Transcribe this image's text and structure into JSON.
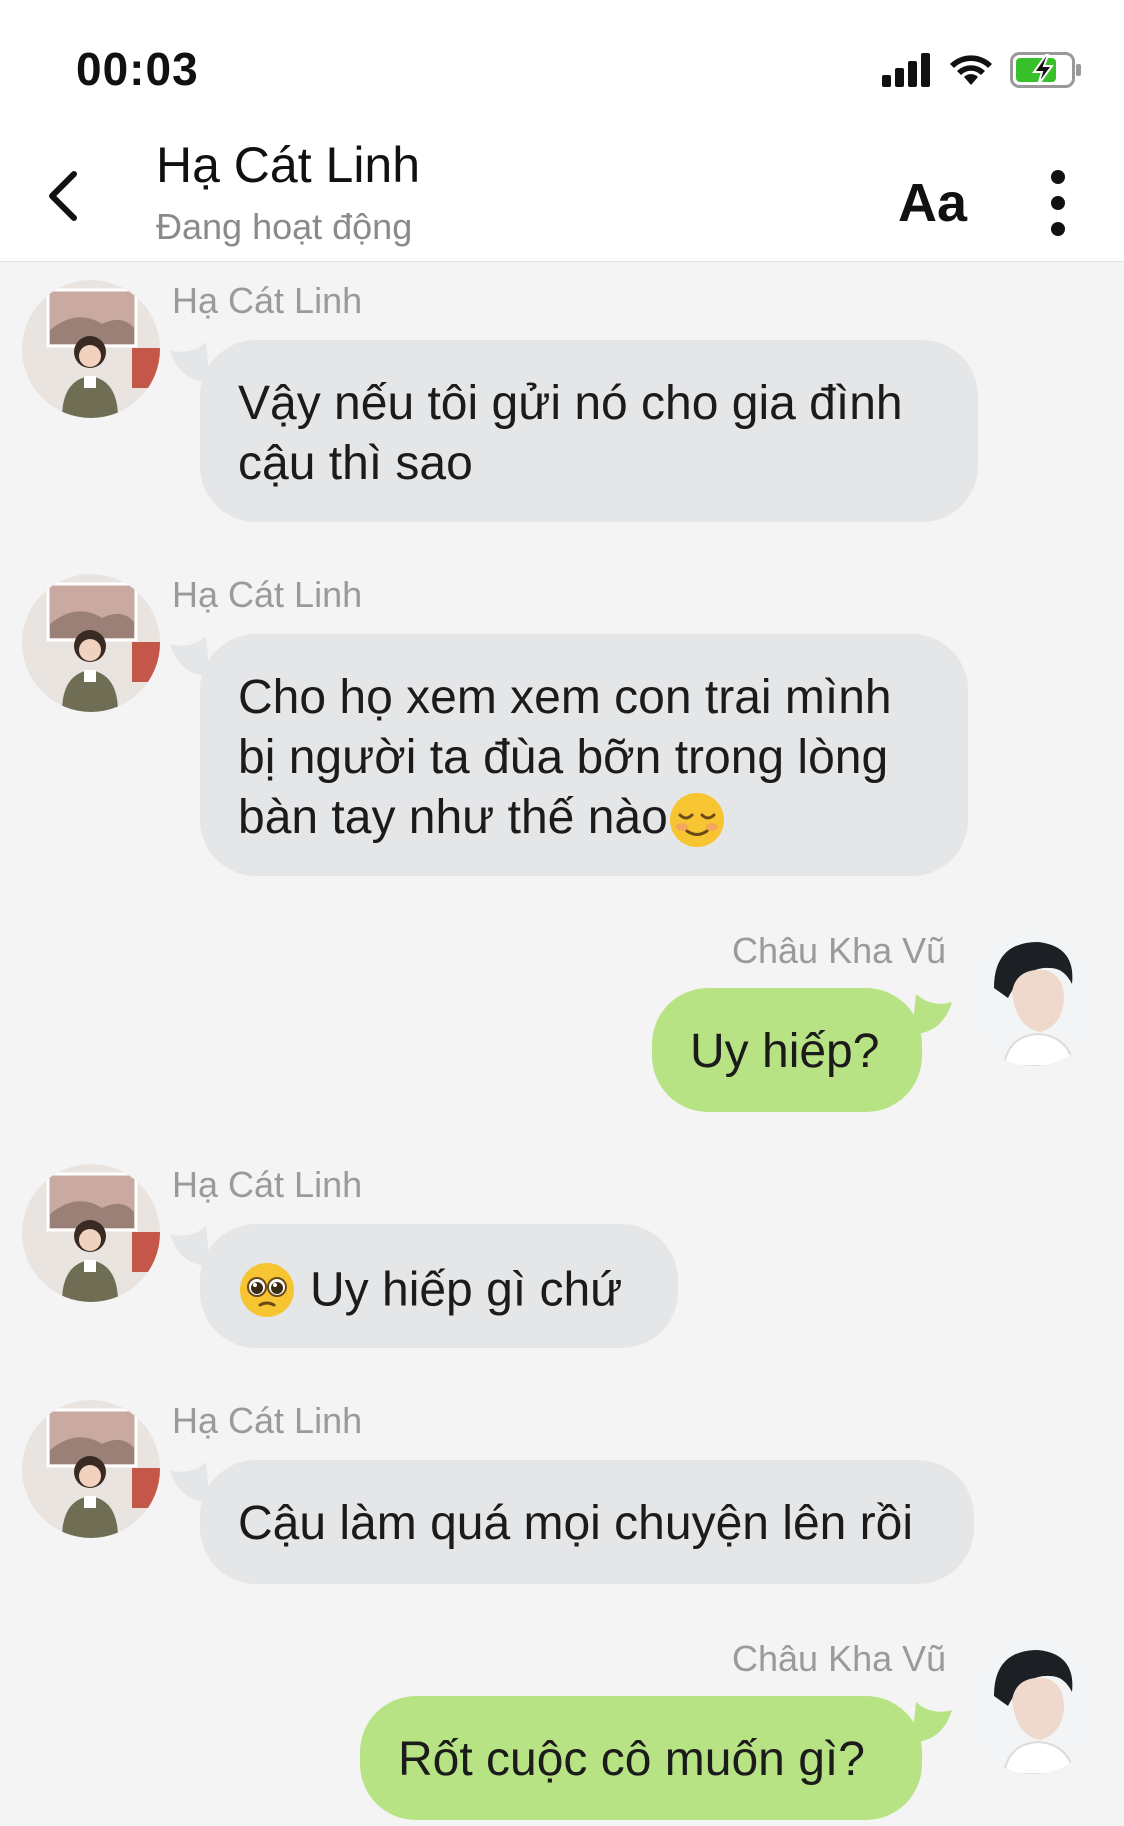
{
  "status_bar": {
    "time": "00:03",
    "battery_color": "#38c02a"
  },
  "header": {
    "name": "Hạ Cát Linh",
    "status": "Đang hoạt động",
    "font_button": "Aa"
  },
  "messages": [
    {
      "side": "in",
      "sender": "Hạ Cát Linh",
      "text": "Vậy nếu tôi gửi nó cho gia đình\ncậu thì sao"
    },
    {
      "side": "in",
      "sender": "Hạ Cát Linh",
      "text": "Cho họ xem xem con trai mình\nbị người ta đùa bỡn trong lòng\nbàn tay như thế nào",
      "emoji_after": "relieved-face"
    },
    {
      "side": "out",
      "sender": "Châu Kha Vũ",
      "text": "Uy hiếp?"
    },
    {
      "side": "in",
      "sender": "Hạ Cát Linh",
      "text": "Uy hiếp gì chứ",
      "emoji_before": "pleading-face"
    },
    {
      "side": "in",
      "sender": "Hạ Cát Linh",
      "text": "Cậu làm quá mọi chuyện lên rồi"
    },
    {
      "side": "out",
      "sender": "Châu Kha Vũ",
      "text": "Rốt cuộc cô muốn gì?"
    }
  ],
  "colors": {
    "incoming_bubble": "#e4e6e8",
    "outgoing_bubble": "#b7e384",
    "background": "#f4f4f4"
  }
}
